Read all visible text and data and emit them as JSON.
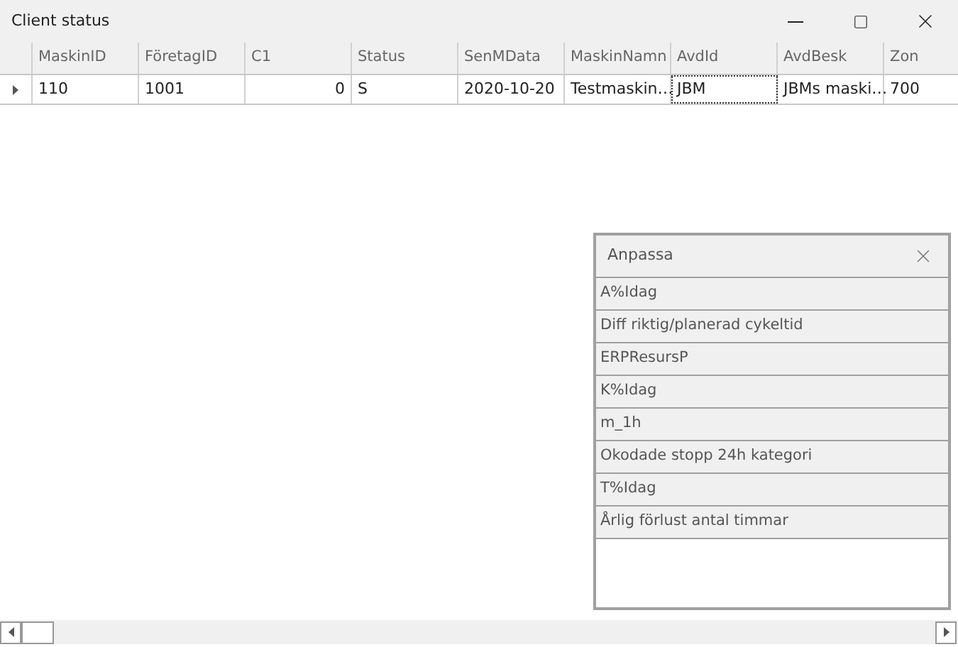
{
  "window": {
    "title": "Client status"
  },
  "table": {
    "columns": [
      "MaskinID",
      "FöretagID",
      "C1",
      "Status",
      "SenMData",
      "MaskinNamn",
      "AvdId",
      "AvdBesk",
      "Zon"
    ],
    "rows": [
      {
        "current": true,
        "cells": [
          {
            "text": "110",
            "kind": "text",
            "focused": false
          },
          {
            "text": "1001",
            "kind": "text",
            "focused": false
          },
          {
            "text": "0",
            "kind": "number",
            "focused": false
          },
          {
            "text": "S",
            "kind": "text",
            "focused": false
          },
          {
            "text": "2020-10-20",
            "kind": "text",
            "focused": false
          },
          {
            "text": "Testmaskin…",
            "kind": "text",
            "focused": false
          },
          {
            "text": "JBM",
            "kind": "text",
            "focused": true
          },
          {
            "text": "JBMs maski…",
            "kind": "text",
            "focused": false
          },
          {
            "text": "700",
            "kind": "text",
            "focused": false
          }
        ]
      }
    ]
  },
  "customize_panel": {
    "title": "Anpassa",
    "items": [
      "A%Idag",
      "Diff riktig/planerad cykeltid",
      "ERPResursP",
      "K%Idag",
      "m_1h",
      "Okodade stopp 24h kategori",
      "T%Idag",
      "Årlig förlust antal timmar"
    ]
  }
}
